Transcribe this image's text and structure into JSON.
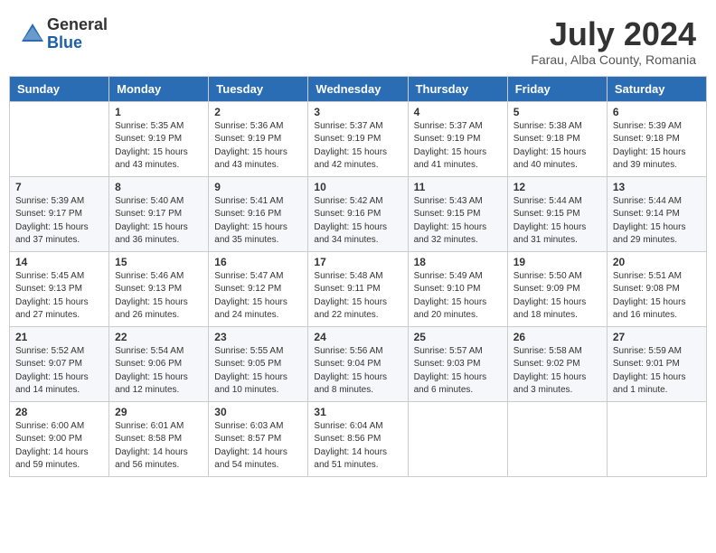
{
  "header": {
    "logo_general": "General",
    "logo_blue": "Blue",
    "month_year": "July 2024",
    "location": "Farau, Alba County, Romania"
  },
  "days_of_week": [
    "Sunday",
    "Monday",
    "Tuesday",
    "Wednesday",
    "Thursday",
    "Friday",
    "Saturday"
  ],
  "weeks": [
    [
      {
        "day": "",
        "content": ""
      },
      {
        "day": "1",
        "content": "Sunrise: 5:35 AM\nSunset: 9:19 PM\nDaylight: 15 hours\nand 43 minutes."
      },
      {
        "day": "2",
        "content": "Sunrise: 5:36 AM\nSunset: 9:19 PM\nDaylight: 15 hours\nand 43 minutes."
      },
      {
        "day": "3",
        "content": "Sunrise: 5:37 AM\nSunset: 9:19 PM\nDaylight: 15 hours\nand 42 minutes."
      },
      {
        "day": "4",
        "content": "Sunrise: 5:37 AM\nSunset: 9:19 PM\nDaylight: 15 hours\nand 41 minutes."
      },
      {
        "day": "5",
        "content": "Sunrise: 5:38 AM\nSunset: 9:18 PM\nDaylight: 15 hours\nand 40 minutes."
      },
      {
        "day": "6",
        "content": "Sunrise: 5:39 AM\nSunset: 9:18 PM\nDaylight: 15 hours\nand 39 minutes."
      }
    ],
    [
      {
        "day": "7",
        "content": "Sunrise: 5:39 AM\nSunset: 9:17 PM\nDaylight: 15 hours\nand 37 minutes."
      },
      {
        "day": "8",
        "content": "Sunrise: 5:40 AM\nSunset: 9:17 PM\nDaylight: 15 hours\nand 36 minutes."
      },
      {
        "day": "9",
        "content": "Sunrise: 5:41 AM\nSunset: 9:16 PM\nDaylight: 15 hours\nand 35 minutes."
      },
      {
        "day": "10",
        "content": "Sunrise: 5:42 AM\nSunset: 9:16 PM\nDaylight: 15 hours\nand 34 minutes."
      },
      {
        "day": "11",
        "content": "Sunrise: 5:43 AM\nSunset: 9:15 PM\nDaylight: 15 hours\nand 32 minutes."
      },
      {
        "day": "12",
        "content": "Sunrise: 5:44 AM\nSunset: 9:15 PM\nDaylight: 15 hours\nand 31 minutes."
      },
      {
        "day": "13",
        "content": "Sunrise: 5:44 AM\nSunset: 9:14 PM\nDaylight: 15 hours\nand 29 minutes."
      }
    ],
    [
      {
        "day": "14",
        "content": "Sunrise: 5:45 AM\nSunset: 9:13 PM\nDaylight: 15 hours\nand 27 minutes."
      },
      {
        "day": "15",
        "content": "Sunrise: 5:46 AM\nSunset: 9:13 PM\nDaylight: 15 hours\nand 26 minutes."
      },
      {
        "day": "16",
        "content": "Sunrise: 5:47 AM\nSunset: 9:12 PM\nDaylight: 15 hours\nand 24 minutes."
      },
      {
        "day": "17",
        "content": "Sunrise: 5:48 AM\nSunset: 9:11 PM\nDaylight: 15 hours\nand 22 minutes."
      },
      {
        "day": "18",
        "content": "Sunrise: 5:49 AM\nSunset: 9:10 PM\nDaylight: 15 hours\nand 20 minutes."
      },
      {
        "day": "19",
        "content": "Sunrise: 5:50 AM\nSunset: 9:09 PM\nDaylight: 15 hours\nand 18 minutes."
      },
      {
        "day": "20",
        "content": "Sunrise: 5:51 AM\nSunset: 9:08 PM\nDaylight: 15 hours\nand 16 minutes."
      }
    ],
    [
      {
        "day": "21",
        "content": "Sunrise: 5:52 AM\nSunset: 9:07 PM\nDaylight: 15 hours\nand 14 minutes."
      },
      {
        "day": "22",
        "content": "Sunrise: 5:54 AM\nSunset: 9:06 PM\nDaylight: 15 hours\nand 12 minutes."
      },
      {
        "day": "23",
        "content": "Sunrise: 5:55 AM\nSunset: 9:05 PM\nDaylight: 15 hours\nand 10 minutes."
      },
      {
        "day": "24",
        "content": "Sunrise: 5:56 AM\nSunset: 9:04 PM\nDaylight: 15 hours\nand 8 minutes."
      },
      {
        "day": "25",
        "content": "Sunrise: 5:57 AM\nSunset: 9:03 PM\nDaylight: 15 hours\nand 6 minutes."
      },
      {
        "day": "26",
        "content": "Sunrise: 5:58 AM\nSunset: 9:02 PM\nDaylight: 15 hours\nand 3 minutes."
      },
      {
        "day": "27",
        "content": "Sunrise: 5:59 AM\nSunset: 9:01 PM\nDaylight: 15 hours\nand 1 minute."
      }
    ],
    [
      {
        "day": "28",
        "content": "Sunrise: 6:00 AM\nSunset: 9:00 PM\nDaylight: 14 hours\nand 59 minutes."
      },
      {
        "day": "29",
        "content": "Sunrise: 6:01 AM\nSunset: 8:58 PM\nDaylight: 14 hours\nand 56 minutes."
      },
      {
        "day": "30",
        "content": "Sunrise: 6:03 AM\nSunset: 8:57 PM\nDaylight: 14 hours\nand 54 minutes."
      },
      {
        "day": "31",
        "content": "Sunrise: 6:04 AM\nSunset: 8:56 PM\nDaylight: 14 hours\nand 51 minutes."
      },
      {
        "day": "",
        "content": ""
      },
      {
        "day": "",
        "content": ""
      },
      {
        "day": "",
        "content": ""
      }
    ]
  ]
}
